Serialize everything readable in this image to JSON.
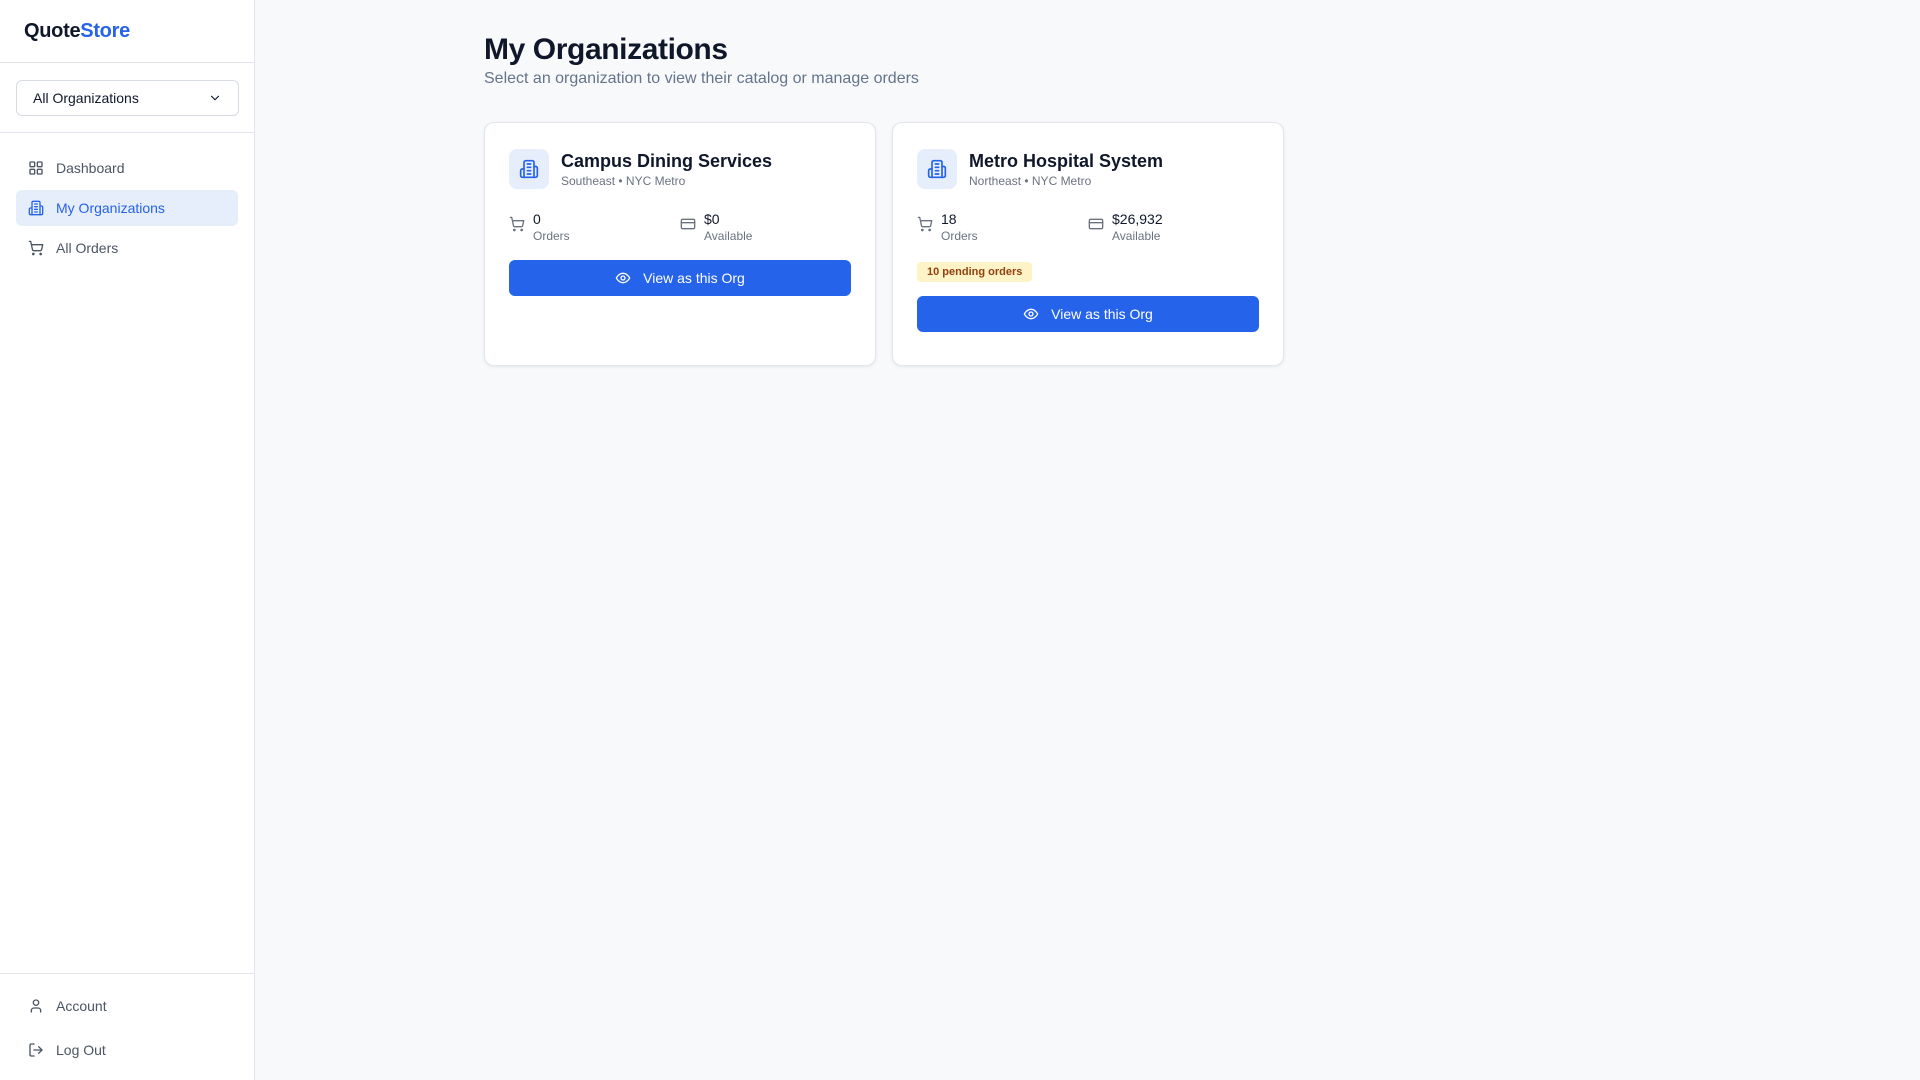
{
  "brand": {
    "part1": "Quote",
    "part2": "Store",
    "accent": "#2563eb"
  },
  "org_select": {
    "value": "All Organizations",
    "icon": "chevron-down-icon"
  },
  "nav": [
    {
      "label": "Dashboard",
      "icon": "dashboard-icon",
      "active": false
    },
    {
      "label": "My Organizations",
      "icon": "building-icon",
      "active": true
    },
    {
      "label": "All Orders",
      "icon": "cart-icon",
      "active": false
    }
  ],
  "bottom_nav": [
    {
      "label": "Account",
      "icon": "user-icon"
    },
    {
      "label": "Log Out",
      "icon": "logout-icon"
    }
  ],
  "page": {
    "title": "My Organizations",
    "subtitle": "Select an organization to view their catalog or manage orders"
  },
  "orgs": [
    {
      "name": "Campus Dining Services",
      "meta": "Southeast • NYC Metro",
      "orders_value": "0",
      "orders_label": "Orders",
      "available_value": "$0",
      "available_label": "Available",
      "badge": "",
      "button_label": "View as this Org"
    },
    {
      "name": "Metro Hospital System",
      "meta": "Northeast • NYC Metro",
      "orders_value": "18",
      "orders_label": "Orders",
      "available_value": "$26,932",
      "available_label": "Available",
      "badge": "10 pending orders",
      "button_label": "View as this Org"
    }
  ]
}
